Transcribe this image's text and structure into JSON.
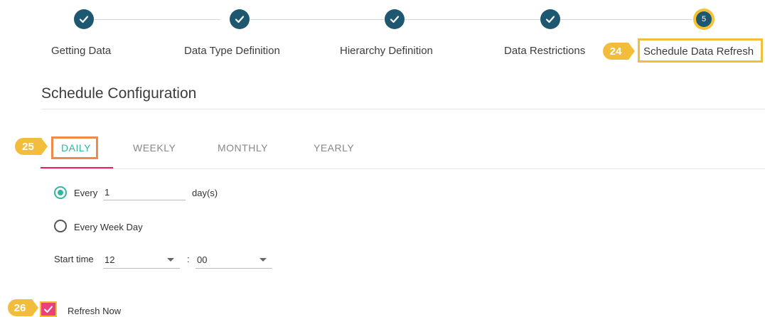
{
  "stepper": {
    "steps": [
      {
        "label": "Getting Data",
        "state": "done"
      },
      {
        "label": "Data Type Definition",
        "state": "done"
      },
      {
        "label": "Hierarchy Definition",
        "state": "done"
      },
      {
        "label": "Data Restrictions",
        "state": "done"
      },
      {
        "label": "Schedule Data Refresh",
        "state": "current",
        "number": "5"
      }
    ]
  },
  "callouts": {
    "c24": "24",
    "c25": "25",
    "c26": "26"
  },
  "section_title": "Schedule Configuration",
  "tabs": [
    {
      "label": "DAILY",
      "active": true
    },
    {
      "label": "WEEKLY",
      "active": false
    },
    {
      "label": "MONTHLY",
      "active": false
    },
    {
      "label": "YEARLY",
      "active": false
    }
  ],
  "daily": {
    "every_label": "Every",
    "every_value": "1",
    "every_unit": "day(s)",
    "weekday_label": "Every Week Day",
    "start_time_label": "Start time",
    "hour_value": "12",
    "separator": ":",
    "minute_value": "00"
  },
  "refresh_now_label": "Refresh Now",
  "colors": {
    "step_done": "#1d5870",
    "step_current_ring": "#f5c135",
    "callout": "#f3bd3c",
    "active_tab": "#33b5a3",
    "tab_underline": "#e91e63",
    "highlight_box_tab": "#f08a4b",
    "checkbox": "#ec407a"
  }
}
